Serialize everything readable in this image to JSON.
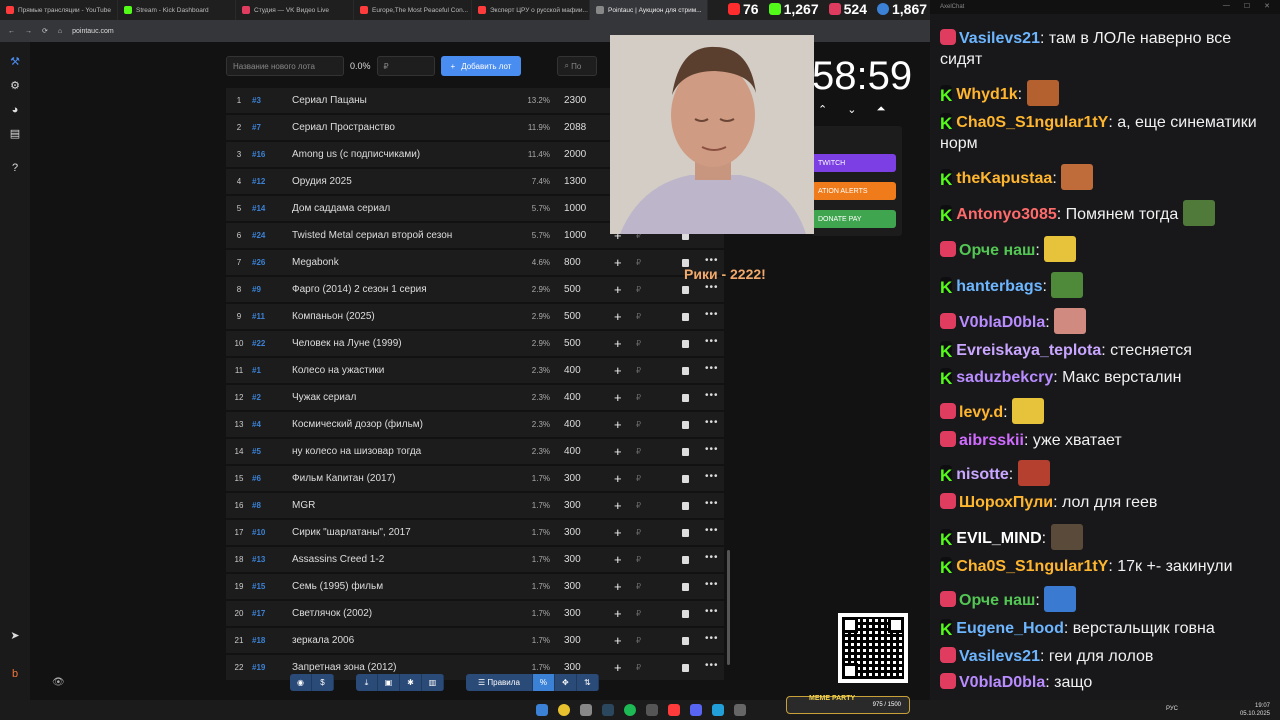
{
  "browser": {
    "tabs": [
      {
        "label": "Прямые трансляции - YouTube",
        "color": "#ff3b3b"
      },
      {
        "label": "Stream - Kick Dashboard",
        "color": "#53fc18"
      },
      {
        "label": "Студия — VK Видео Live",
        "color": "#e03c5f"
      },
      {
        "label": "Europe,The Most Peaceful Con...",
        "color": "#ff3b3b"
      },
      {
        "label": "Эксперт ЦРУ о русской мафии...",
        "color": "#ff3b3b"
      },
      {
        "label": "Pointauc | Аукцион для стрим...",
        "color": "#888888",
        "active": true
      }
    ],
    "url": "pointauc.com"
  },
  "stats": {
    "youtube": "76",
    "kick": "1,267",
    "vk": "524",
    "total": "1,867"
  },
  "toolbar_top": {
    "lot_name_placeholder": "Название нового лота",
    "percent": "0.0%",
    "currency_placeholder": "₽",
    "add_label": "Добавить лот",
    "search_placeholder": "По"
  },
  "lots": [
    {
      "n": "1",
      "id": "#3",
      "name": "Сериал Пацаны",
      "pct": "13.2%",
      "amount": "2300"
    },
    {
      "n": "2",
      "id": "#7",
      "name": "Сериал Пространство",
      "pct": "11.9%",
      "amount": "2088"
    },
    {
      "n": "3",
      "id": "#16",
      "name": "Among us (с подписчиками)",
      "pct": "11.4%",
      "amount": "2000"
    },
    {
      "n": "4",
      "id": "#12",
      "name": "Орудия 2025",
      "pct": "7.4%",
      "amount": "1300"
    },
    {
      "n": "5",
      "id": "#14",
      "name": "Дом саддама сериал",
      "pct": "5.7%",
      "amount": "1000"
    },
    {
      "n": "6",
      "id": "#24",
      "name": "Twisted Metal сериал второй сезон",
      "pct": "5.7%",
      "amount": "1000"
    },
    {
      "n": "7",
      "id": "#26",
      "name": "Megabonk",
      "pct": "4.6%",
      "amount": "800"
    },
    {
      "n": "8",
      "id": "#9",
      "name": "Фарго (2014) 2 сезон 1 серия",
      "pct": "2.9%",
      "amount": "500"
    },
    {
      "n": "9",
      "id": "#11",
      "name": "Компаньон (2025)",
      "pct": "2.9%",
      "amount": "500"
    },
    {
      "n": "10",
      "id": "#22",
      "name": "Человек на Луне (1999)",
      "pct": "2.9%",
      "amount": "500"
    },
    {
      "n": "11",
      "id": "#1",
      "name": "Колесо на ужастики",
      "pct": "2.3%",
      "amount": "400"
    },
    {
      "n": "12",
      "id": "#2",
      "name": "Чужак сериал",
      "pct": "2.3%",
      "amount": "400"
    },
    {
      "n": "13",
      "id": "#4",
      "name": "Космический дозор (фильм)",
      "pct": "2.3%",
      "amount": "400"
    },
    {
      "n": "14",
      "id": "#5",
      "name": "ну колесо на шизовар тогда",
      "pct": "2.3%",
      "amount": "400"
    },
    {
      "n": "15",
      "id": "#6",
      "name": "Фильм Капитан (2017)",
      "pct": "1.7%",
      "amount": "300"
    },
    {
      "n": "16",
      "id": "#8",
      "name": "MGR",
      "pct": "1.7%",
      "amount": "300"
    },
    {
      "n": "17",
      "id": "#10",
      "name": "Сирик \"шарлатаны\", 2017",
      "pct": "1.7%",
      "amount": "300"
    },
    {
      "n": "18",
      "id": "#13",
      "name": "Assassins Creed 1-2",
      "pct": "1.7%",
      "amount": "300"
    },
    {
      "n": "19",
      "id": "#15",
      "name": "Семь (1995) фильм",
      "pct": "1.7%",
      "amount": "300"
    },
    {
      "n": "20",
      "id": "#17",
      "name": "Светлячок (2002)",
      "pct": "1.7%",
      "amount": "300"
    },
    {
      "n": "21",
      "id": "#18",
      "name": "зеркала 2006",
      "pct": "1.7%",
      "amount": "300"
    },
    {
      "n": "22",
      "id": "#19",
      "name": "Запретная зона (2012)",
      "pct": "1.7%",
      "amount": "300"
    }
  ],
  "timer": {
    "value": "58:59"
  },
  "integrations": {
    "twitch": "TWITCH",
    "alerts": "ATION ALERTS",
    "donatepay": "DONATE PAY"
  },
  "overlay_text": "Рики - 2222!",
  "bottom_toolbar": {
    "rules": "Правила",
    "percent": "%"
  },
  "taskbar": {
    "lang": "РУС",
    "time": "19:07",
    "date": "05.10.2025",
    "meme_label": "MEME PARTY",
    "meme_progress": "975 / 1500"
  },
  "chat": {
    "title": "AxelChat",
    "messages": [
      {
        "platform": "live",
        "user": "Vasilevs21",
        "color": "#6db6ff",
        "text": "там в ЛОЛе наверно все сидят"
      },
      {
        "platform": "kick",
        "user": "Whyd1k",
        "color": "#ffb62e",
        "text": "",
        "emote": "#b5602f"
      },
      {
        "platform": "kick",
        "user": "Cha0S_S1ngular1tY",
        "color": "#ffb62e",
        "text": "а, еще синематики норм"
      },
      {
        "platform": "kick",
        "user": "theKapustaa",
        "color": "#ffb62e",
        "text": "",
        "emote": "#c06b3a"
      },
      {
        "platform": "kick",
        "user": "Antonyo3085",
        "color": "#ff6b6b",
        "text": "Помянем тогда",
        "emote": "#4f7a3a"
      },
      {
        "platform": "live",
        "user": "Орче наш",
        "color": "#53c653",
        "text": "",
        "emote": "#e6c33a"
      },
      {
        "platform": "kick",
        "user": "hanterbags",
        "color": "#6db6ff",
        "text": "",
        "emote": "#4f8a3a"
      },
      {
        "platform": "live",
        "user": "V0blaD0bla",
        "color": "#b98cff",
        "text": "",
        "emote": "#d08a80"
      },
      {
        "platform": "kick",
        "user": "Evreiskaya_teplota",
        "color": "#c9a6ff",
        "text": "стесняется"
      },
      {
        "platform": "kick",
        "user": "saduzbekcry",
        "color": "#b98cff",
        "text": "Макс версталин"
      },
      {
        "platform": "live",
        "user": "levy.d",
        "color": "#ffb62e",
        "text": "",
        "emote": "#e6c33a"
      },
      {
        "platform": "live",
        "user": "aibrsskii",
        "color": "#d06bff",
        "text": "уже хватает"
      },
      {
        "platform": "kick",
        "user": "nisotte",
        "color": "#c9a6ff",
        "text": "",
        "emote": "#b5402f"
      },
      {
        "platform": "live",
        "user": "ШорохПули",
        "color": "#ffb62e",
        "text": "лол для геев"
      },
      {
        "platform": "kick",
        "user": "EVIL_MIND",
        "color": "#ffffff",
        "text": "",
        "emote": "#5a4a3a"
      },
      {
        "platform": "kick",
        "user": "Cha0S_S1ngular1tY",
        "color": "#ffb62e",
        "text": "17к +- закинули"
      },
      {
        "platform": "live",
        "user": "Орче наш",
        "color": "#53c653",
        "text": "",
        "emote": "#3a7ad0"
      },
      {
        "platform": "kick",
        "user": "Eugene_Hood",
        "color": "#6db6ff",
        "text": "верстальщик говна"
      },
      {
        "platform": "live",
        "user": "Vasilevs21",
        "color": "#6db6ff",
        "text": "геи для лолов"
      },
      {
        "platform": "live",
        "user": "V0blaD0bla",
        "color": "#b98cff",
        "text": "защо"
      }
    ]
  }
}
